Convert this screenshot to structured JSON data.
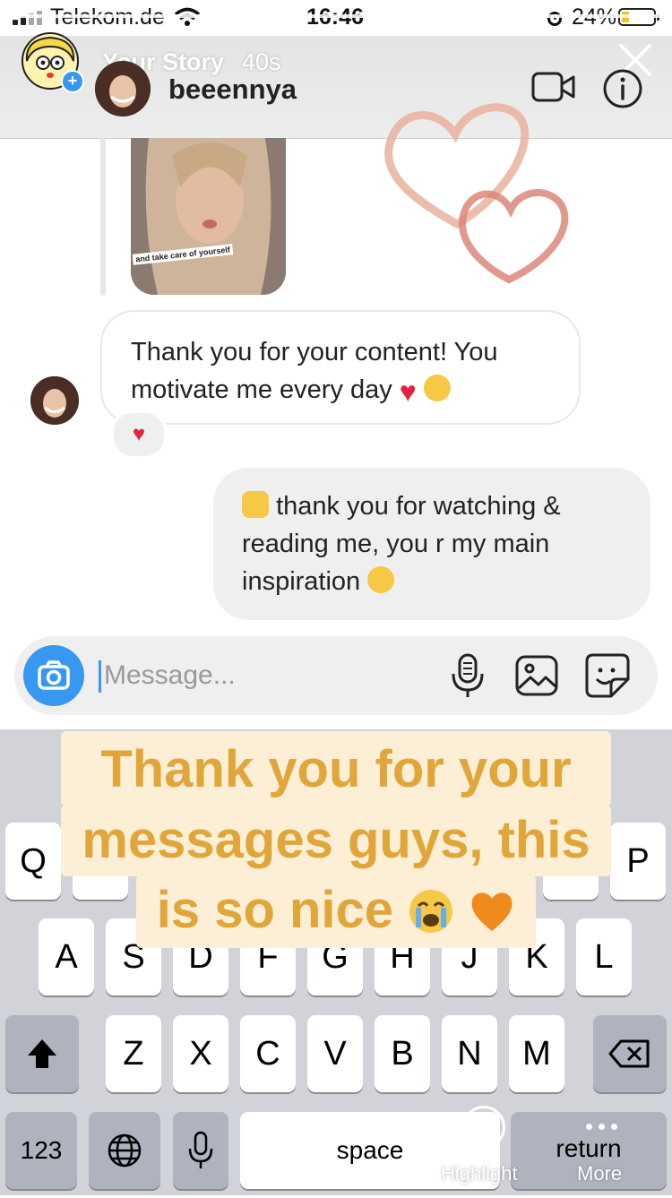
{
  "status_bar": {
    "carrier": "Telekom.de",
    "time": "16:46",
    "battery": "24%",
    "battery_level": 0.24,
    "icons": [
      "signal-icon",
      "wifi-icon",
      "alarm-icon",
      "battery-icon"
    ]
  },
  "story": {
    "title": "Your Story",
    "age": "40s",
    "progress_segments": 3,
    "icons": [
      "close-icon",
      "plus-badge-icon"
    ]
  },
  "chat": {
    "name": "beeennya",
    "icons": [
      "video-call-icon",
      "info-icon"
    ],
    "story_thumbnail_caption": "and take care of yourself",
    "incoming_message": {
      "text": "Thank you for your content! You motivate me every day",
      "emojis": [
        "red-heart",
        "face-blowing-kiss"
      ],
      "reaction": "red-heart"
    },
    "outgoing_message": {
      "text": "thank you for watching & reading me, you r my main inspiration",
      "emojis": [
        "raising-hands",
        "smiling-face-with-hearts"
      ]
    }
  },
  "composer": {
    "placeholder": "Message...",
    "icons": [
      "camera-icon",
      "microphone-icon",
      "gallery-icon",
      "sticker-icon"
    ]
  },
  "story_text": {
    "lines": [
      "Thank you for your",
      "messages guys, this",
      "is so nice"
    ],
    "emojis": [
      "loudly-crying-face",
      "orange-heart"
    ],
    "color": "#e0a63a",
    "background": "#fcefd6"
  },
  "keyboard": {
    "row1_visible": [
      "Q",
      "P"
    ],
    "row2": [
      "A",
      "S",
      "D",
      "F",
      "G",
      "H",
      "J",
      "K",
      "L"
    ],
    "row3": [
      "Z",
      "X",
      "C",
      "V",
      "B",
      "N",
      "M"
    ],
    "numbers_key": "123",
    "space_key": "space",
    "return_key": "return",
    "icons": [
      "shift-icon",
      "delete-icon",
      "globe-icon",
      "dictation-icon"
    ]
  },
  "story_actions": {
    "highlight": "Highlight",
    "more": "More",
    "icons": [
      "highlight-heart-icon",
      "more-dots-icon"
    ]
  }
}
